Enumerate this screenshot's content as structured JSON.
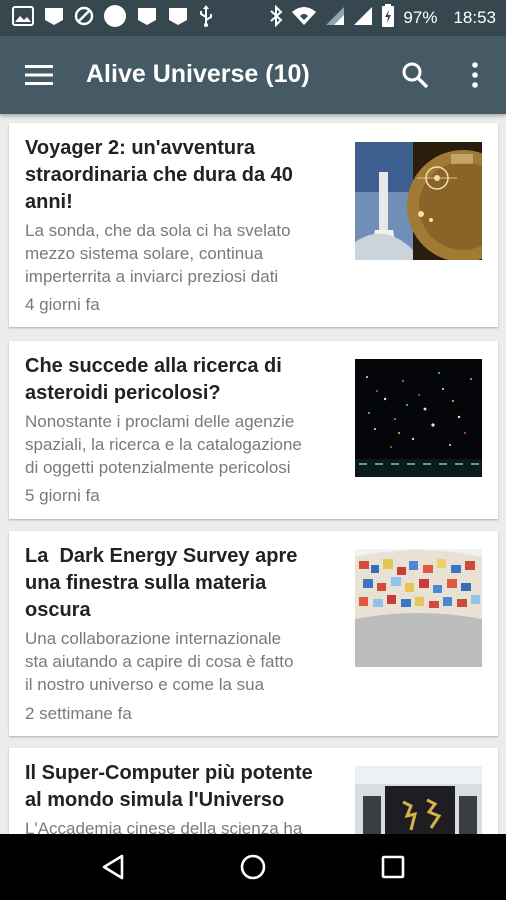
{
  "status_bar": {
    "battery": "97%",
    "time": "18:53",
    "icons": [
      "image-icon",
      "notification-icon",
      "blocked-icon",
      "circle-icon",
      "notification-icon",
      "notification-icon",
      "usb-icon",
      "bluetooth-icon",
      "wifi-icon",
      "signal-icon",
      "signal-icon",
      "battery-icon"
    ]
  },
  "app_bar": {
    "title": "Alive Universe (10)",
    "icons": [
      "menu-icon",
      "search-icon",
      "more-vert-icon"
    ]
  },
  "articles": [
    {
      "title_lines": [
        "Voyager 2: un'avventura",
        "straordinaria che dura da 40",
        "anni!"
      ],
      "summary_lines": [
        "La sonda, che da sola ci ha svelato",
        "mezzo sistema solare, continua",
        "imperterrita a inviarci preziosi dati"
      ],
      "time": "4 giorni fa",
      "thumbnail": "voyager-golden-record"
    },
    {
      "title_lines": [
        "Che succede alla ricerca di",
        "asteroidi pericolosi?"
      ],
      "summary_lines": [
        "Nonostante i proclami delle agenzie",
        "spaziali, la ricerca e la catalogazione",
        "di oggetti potenzialmente pericolosi"
      ],
      "time": "5 giorni fa",
      "thumbnail": "asteroid-star-field"
    },
    {
      "title_lines": [
        "La  Dark Energy Survey apre",
        "una finestra sulla materia",
        "oscura"
      ],
      "summary_lines": [
        "Una collaborazione internazionale",
        "sta aiutando a capire di cosa è fatto",
        "il nostro universo e come la sua"
      ],
      "time": "2 settimane fa",
      "thumbnail": "dark-matter-map"
    },
    {
      "title_lines": [
        "Il Super-Computer più potente",
        "al mondo simula l'Universo"
      ],
      "summary_lines": [
        "L'Accademia cinese della scienza ha"
      ],
      "time": "",
      "thumbnail": "supercomputer"
    }
  ],
  "nav_bar": {
    "icons": [
      "back-icon",
      "home-icon",
      "recents-icon"
    ]
  },
  "colors": {
    "status_bar": "#37474f",
    "app_bar": "#455a64",
    "background": "#ececec",
    "title_text": "#222222",
    "secondary_text": "#7a7a7a"
  }
}
